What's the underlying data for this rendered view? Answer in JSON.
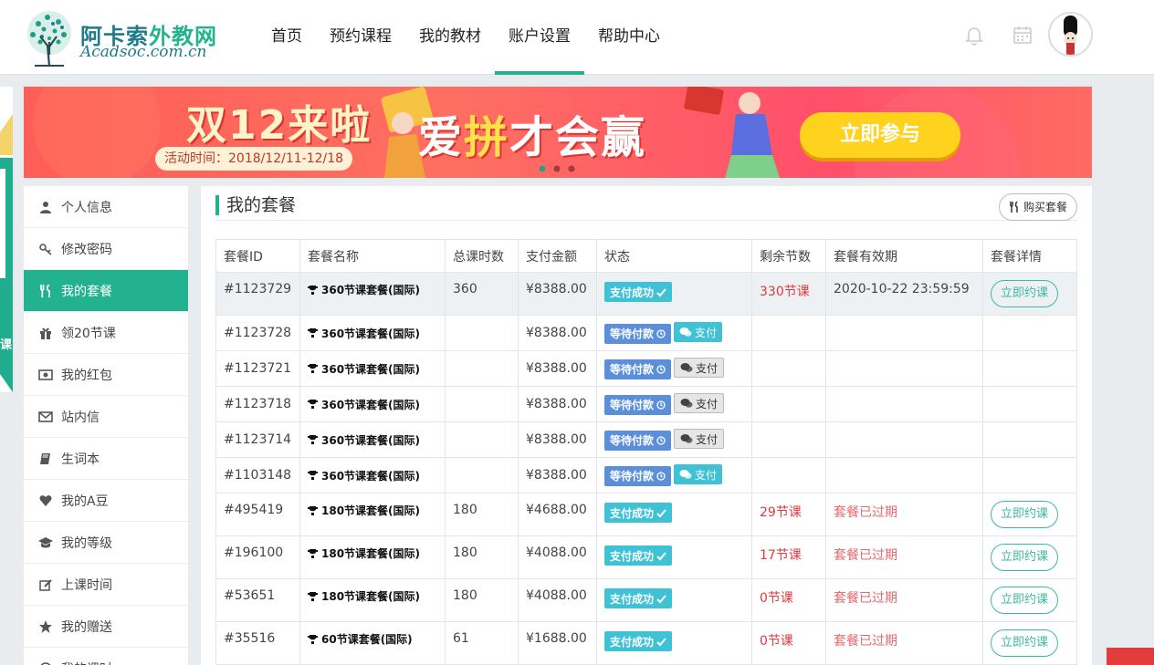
{
  "header": {
    "logo_cn_a": "阿卡索",
    "logo_cn_b": "外教网",
    "logo_en": "Acadsoc.com.cn",
    "nav": [
      "首页",
      "预约课程",
      "我的教材",
      "账户设置",
      "帮助中心"
    ],
    "active_nav": "账户设置",
    "icons": [
      "bell-icon",
      "calendar-icon",
      "avatar"
    ]
  },
  "banner": {
    "headline": "双12来啦",
    "slogan_a": "爱",
    "slogan_b": "拼",
    "slogan_c": "才会赢",
    "date": "活动时间：2018/12/11-12/18",
    "cta": "立即参与",
    "edge_text": "课"
  },
  "sidebar": {
    "items": [
      {
        "label": "个人信息",
        "icon": "user-icon"
      },
      {
        "label": "修改密码",
        "icon": "key-icon"
      },
      {
        "label": "我的套餐",
        "icon": "utensils-icon"
      },
      {
        "label": "领20节课",
        "icon": "gift-icon"
      },
      {
        "label": "我的红包",
        "icon": "money-icon"
      },
      {
        "label": "站内信",
        "icon": "envelope-icon"
      },
      {
        "label": "生词本",
        "icon": "book-icon"
      },
      {
        "label": "我的A豆",
        "icon": "heart-icon"
      },
      {
        "label": "我的等级",
        "icon": "graduation-cap-icon"
      },
      {
        "label": "上课时间",
        "icon": "edit-icon"
      },
      {
        "label": "我的赠送",
        "icon": "star-icon"
      },
      {
        "label": "我的课时",
        "icon": "clock-icon"
      }
    ],
    "active_index": 2
  },
  "main": {
    "title": "我的套餐",
    "buy_label": "购买套餐",
    "columns": [
      "套餐ID",
      "套餐名称",
      "总课时数",
      "支付金额",
      "状态",
      "剩余节数",
      "套餐有效期",
      "套餐详情"
    ],
    "rows": [
      {
        "id": "#1123729",
        "name": "360节课套餐(国际)",
        "total": "360",
        "amount": "¥8388.00",
        "status": "支付成功",
        "status_type": "ok",
        "pay": "",
        "remaining": "330节课",
        "validity": "2020-10-22 23:59:59",
        "validity_type": "normal",
        "action": "立即约课"
      },
      {
        "id": "#1123728",
        "name": "360节课套餐(国际)",
        "total": "",
        "amount": "¥8388.00",
        "status": "等待付款",
        "status_type": "wait",
        "pay": "支付",
        "pay_style": "cyan",
        "remaining": "",
        "validity": "",
        "validity_type": "normal",
        "action": ""
      },
      {
        "id": "#1123721",
        "name": "360节课套餐(国际)",
        "total": "",
        "amount": "¥8388.00",
        "status": "等待付款",
        "status_type": "wait",
        "pay": "支付",
        "pay_style": "gray",
        "remaining": "",
        "validity": "",
        "validity_type": "normal",
        "action": ""
      },
      {
        "id": "#1123718",
        "name": "360节课套餐(国际)",
        "total": "",
        "amount": "¥8388.00",
        "status": "等待付款",
        "status_type": "wait",
        "pay": "支付",
        "pay_style": "gray",
        "remaining": "",
        "validity": "",
        "validity_type": "normal",
        "action": ""
      },
      {
        "id": "#1123714",
        "name": "360节课套餐(国际)",
        "total": "",
        "amount": "¥8388.00",
        "status": "等待付款",
        "status_type": "wait",
        "pay": "支付",
        "pay_style": "gray",
        "remaining": "",
        "validity": "",
        "validity_type": "normal",
        "action": ""
      },
      {
        "id": "#1103148",
        "name": "360节课套餐(国际)",
        "total": "",
        "amount": "¥8388.00",
        "status": "等待付款",
        "status_type": "wait",
        "pay": "支付",
        "pay_style": "cyan",
        "remaining": "",
        "validity": "",
        "validity_type": "normal",
        "action": ""
      },
      {
        "id": "#495419",
        "name": "180节课套餐(国际)",
        "total": "180",
        "amount": "¥4688.00",
        "status": "支付成功",
        "status_type": "ok",
        "pay": "",
        "remaining": "29节课",
        "validity": "套餐已过期",
        "validity_type": "expired",
        "action": "立即约课"
      },
      {
        "id": "#196100",
        "name": "180节课套餐(国际)",
        "total": "180",
        "amount": "¥4088.00",
        "status": "支付成功",
        "status_type": "ok",
        "pay": "",
        "remaining": "17节课",
        "validity": "套餐已过期",
        "validity_type": "expired",
        "action": "立即约课"
      },
      {
        "id": "#53651",
        "name": "180节课套餐(国际)",
        "total": "180",
        "amount": "¥4088.00",
        "status": "支付成功",
        "status_type": "ok",
        "pay": "",
        "remaining": "0节课",
        "validity": "套餐已过期",
        "validity_type": "expired",
        "action": "立即约课"
      },
      {
        "id": "#35516",
        "name": "60节课套餐(国际)",
        "total": "61",
        "amount": "¥1688.00",
        "status": "支付成功",
        "status_type": "ok",
        "pay": "",
        "remaining": "0节课",
        "validity": "套餐已过期",
        "validity_type": "expired",
        "action": "立即约课"
      }
    ]
  },
  "colors": {
    "accent": "#23b28f",
    "ok_badge": "#3fc1d6",
    "wait_badge": "#5b8fd9",
    "red": "#e2393e"
  }
}
